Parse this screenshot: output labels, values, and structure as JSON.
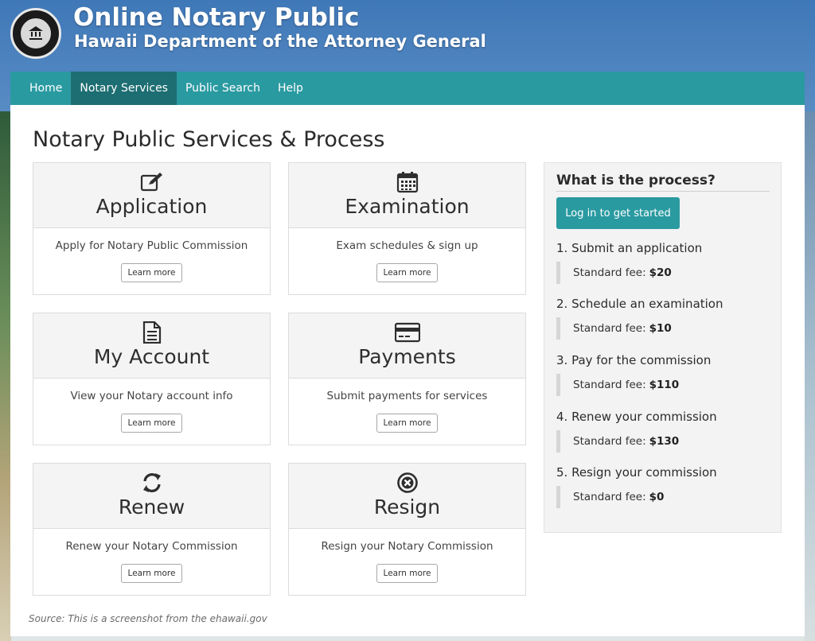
{
  "header": {
    "title": "Online Notary Public",
    "subtitle": "Hawaii Department of the Attorney General",
    "seal": "Attorney General State of Hawaii seal"
  },
  "nav": {
    "items": [
      {
        "label": "Home",
        "active": false
      },
      {
        "label": "Notary Services",
        "active": true
      },
      {
        "label": "Public Search",
        "active": false
      },
      {
        "label": "Help",
        "active": false
      }
    ]
  },
  "main": {
    "title": "Notary Public Services & Process",
    "cards": [
      {
        "icon": "edit-icon",
        "title": "Application",
        "description": "Apply for Notary Public Commission",
        "button": "Learn more"
      },
      {
        "icon": "calendar-icon",
        "title": "Examination",
        "description": "Exam schedules & sign up",
        "button": "Learn more"
      },
      {
        "icon": "document-icon",
        "title": "My Account",
        "description": "View your Notary account info",
        "button": "Learn more"
      },
      {
        "icon": "credit-card-icon",
        "title": "Payments",
        "description": "Submit payments for services",
        "button": "Learn more"
      },
      {
        "icon": "refresh-icon",
        "title": "Renew",
        "description": "Renew your Notary Commission",
        "button": "Learn more"
      },
      {
        "icon": "close-circle-icon",
        "title": "Resign",
        "description": "Resign your Notary Commission",
        "button": "Learn more"
      }
    ]
  },
  "process": {
    "title": "What is the process?",
    "login_button": "Log in to get started",
    "fee_label": "Standard fee:",
    "steps": [
      {
        "title": "1. Submit an application",
        "fee": "$20"
      },
      {
        "title": "2. Schedule an examination",
        "fee": "$10"
      },
      {
        "title": "3. Pay for the commission",
        "fee": "$110"
      },
      {
        "title": "4. Renew your commission",
        "fee": "$130"
      },
      {
        "title": "5. Resign your commission",
        "fee": "$0"
      }
    ]
  },
  "footer": {
    "source": "Source: This is a screenshot from the ehawaii.gov"
  },
  "colors": {
    "nav": "#2a9aa1",
    "nav_active": "#1d6e72",
    "button": "#2a9aa1"
  }
}
